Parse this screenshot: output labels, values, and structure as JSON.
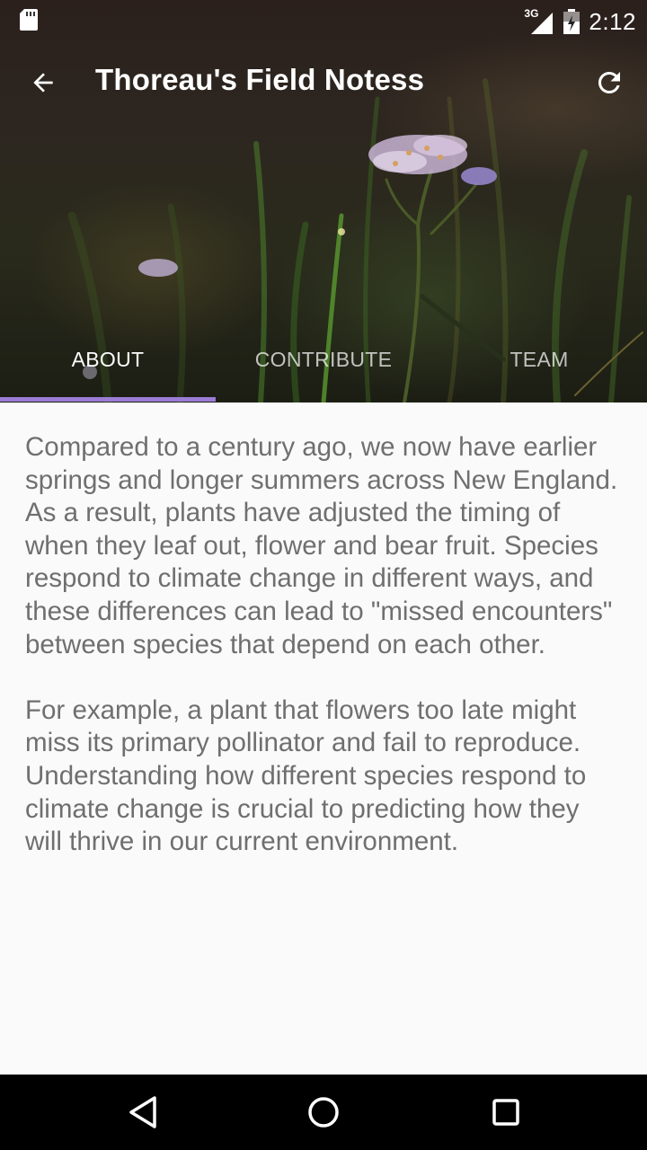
{
  "status_bar": {
    "network_type": "3G",
    "time": "2:12"
  },
  "toolbar": {
    "title": "Thoreau's Field Notess",
    "back_icon": "arrow-back-icon",
    "refresh_icon": "refresh-icon"
  },
  "tabs": [
    {
      "label": "ABOUT",
      "active": true
    },
    {
      "label": "CONTRIBUTE",
      "active": false
    },
    {
      "label": "TEAM",
      "active": false
    }
  ],
  "content": {
    "paragraphs": [
      "Compared to a century ago, we now have earlier springs and longer summers across New England. As a result, plants have adjusted the timing of when they leaf out, flower and bear fruit.  Species respond to climate change in different ways, and these differences can lead to \"missed encounters\" between species that depend on each other.",
      "For example, a plant that flowers too late might miss its primary pollinator and fail to reproduce. Understanding how different species respond to climate change is crucial to predicting how they will thrive in our current environment."
    ]
  },
  "colors": {
    "tab_indicator": "#9b7cd6",
    "body_text": "#6f6f6f",
    "content_bg": "#fafafa"
  },
  "navbar": {
    "back": "nav-back-icon",
    "home": "nav-home-icon",
    "recents": "nav-recents-icon"
  }
}
